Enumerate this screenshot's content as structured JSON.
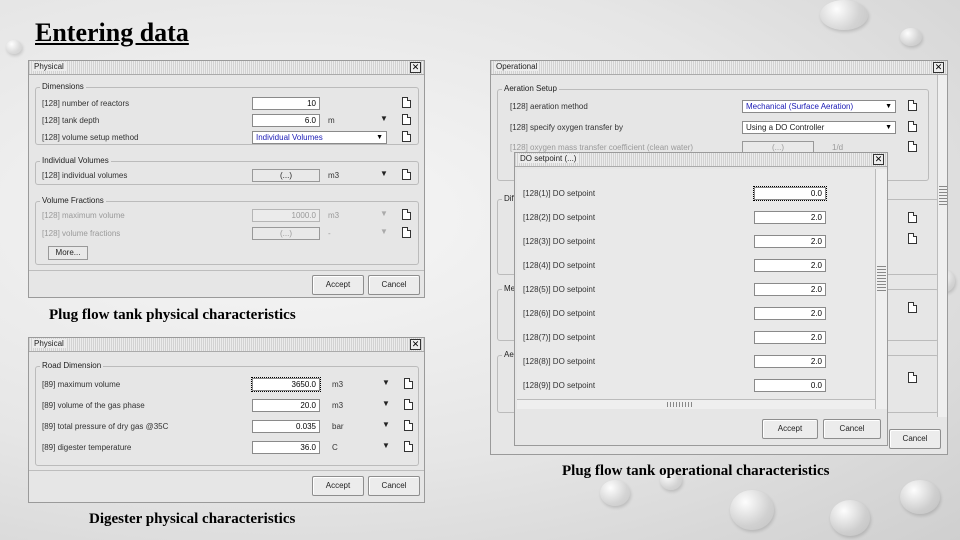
{
  "slide": {
    "title": "Entering data",
    "captions": {
      "plug_physical": "Plug flow tank physical characteristics",
      "plug_operational": "Plug flow tank operational characteristics",
      "digester_physical": "Digester physical characteristics"
    }
  },
  "physical_window": {
    "title": "Physical",
    "dimensions": {
      "legend": "Dimensions",
      "rows": [
        {
          "label": "[128] number of reactors",
          "value": "10"
        },
        {
          "label": "[128] tank depth",
          "value": "6.0",
          "unit": "m"
        },
        {
          "label": "[128] volume setup method",
          "value": "Individual Volumes"
        }
      ]
    },
    "individual": {
      "legend": "Individual Volumes",
      "label": "[128] individual volumes",
      "button": "(...)",
      "unit": "m3"
    },
    "fractions": {
      "legend": "Volume Fractions",
      "rows": [
        {
          "label": "[128] maximum volume",
          "value": "1000.0",
          "unit": "m3"
        },
        {
          "label": "[128] volume fractions",
          "value": "(...)",
          "unit": "-"
        }
      ]
    },
    "more_button": "More...",
    "accept": "Accept",
    "cancel": "Cancel"
  },
  "operational_window": {
    "title": "Operational",
    "aeration": {
      "legend": "Aeration Setup",
      "rows": [
        {
          "label": "[128] aeration method",
          "value": "Mechanical (Surface Aeration)"
        },
        {
          "label": "[128] specify oxygen transfer by",
          "value": "Using a DO Controller"
        },
        {
          "label": "[128] oxygen mass transfer coefficient (clean water)",
          "value": "(...)",
          "unit": "1/d"
        }
      ]
    },
    "partial_legends": [
      "Diff",
      "Mec",
      "Aer"
    ],
    "cancel": "Cancel"
  },
  "do_window": {
    "title": "DO setpoint (...)",
    "rows": [
      {
        "label": "[128(1)] DO setpoint",
        "value": "0.0"
      },
      {
        "label": "[128(2)] DO setpoint",
        "value": "2.0"
      },
      {
        "label": "[128(3)] DO setpoint",
        "value": "2.0"
      },
      {
        "label": "[128(4)] DO setpoint",
        "value": "2.0"
      },
      {
        "label": "[128(5)] DO setpoint",
        "value": "2.0"
      },
      {
        "label": "[128(6)] DO setpoint",
        "value": "2.0"
      },
      {
        "label": "[128(7)] DO setpoint",
        "value": "2.0"
      },
      {
        "label": "[128(8)] DO setpoint",
        "value": "2.0"
      },
      {
        "label": "[128(9)] DO setpoint",
        "value": "0.0"
      }
    ],
    "accept": "Accept",
    "cancel": "Cancel"
  },
  "digester_window": {
    "title": "Physical",
    "legend": "Road Dimension",
    "rows": [
      {
        "label": "[89] maximum volume",
        "value": "3650.0",
        "unit": "m3"
      },
      {
        "label": "[89] volume of the gas phase",
        "value": "20.0",
        "unit": "m3"
      },
      {
        "label": "[89] total pressure of dry gas @35C",
        "value": "0.035",
        "unit": "bar"
      },
      {
        "label": "[89] digester temperature",
        "value": "36.0",
        "unit": "C"
      }
    ],
    "accept": "Accept",
    "cancel": "Cancel"
  }
}
